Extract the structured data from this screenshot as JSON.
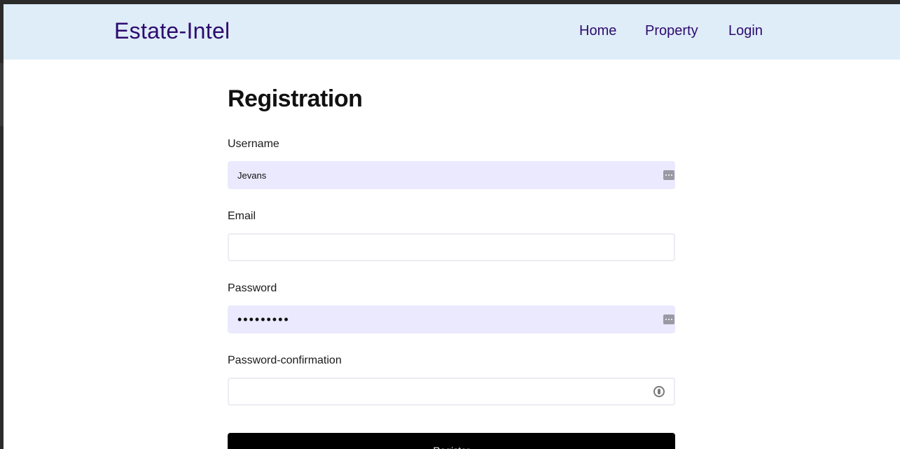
{
  "navbar": {
    "brand": "Estate-Intel",
    "links": [
      "Home",
      "Property",
      "Login"
    ]
  },
  "form": {
    "title": "Registration",
    "username": {
      "label": "Username",
      "value": "Jevans"
    },
    "email": {
      "label": "Email",
      "value": ""
    },
    "password": {
      "label": "Password",
      "value": "•••••••••"
    },
    "password_confirmation": {
      "label": "Password-confirmation",
      "value": ""
    },
    "submit_label": "Register"
  },
  "colors": {
    "navbar_bg": "#deedf8",
    "brand_color": "#2e0a6e",
    "autofill_bg": "#ebe9fd",
    "button_bg": "#000000"
  },
  "icons": {
    "username_field": "password-manager-icon",
    "password_field": "password-manager-icon",
    "confirmation_field": "key-icon"
  }
}
